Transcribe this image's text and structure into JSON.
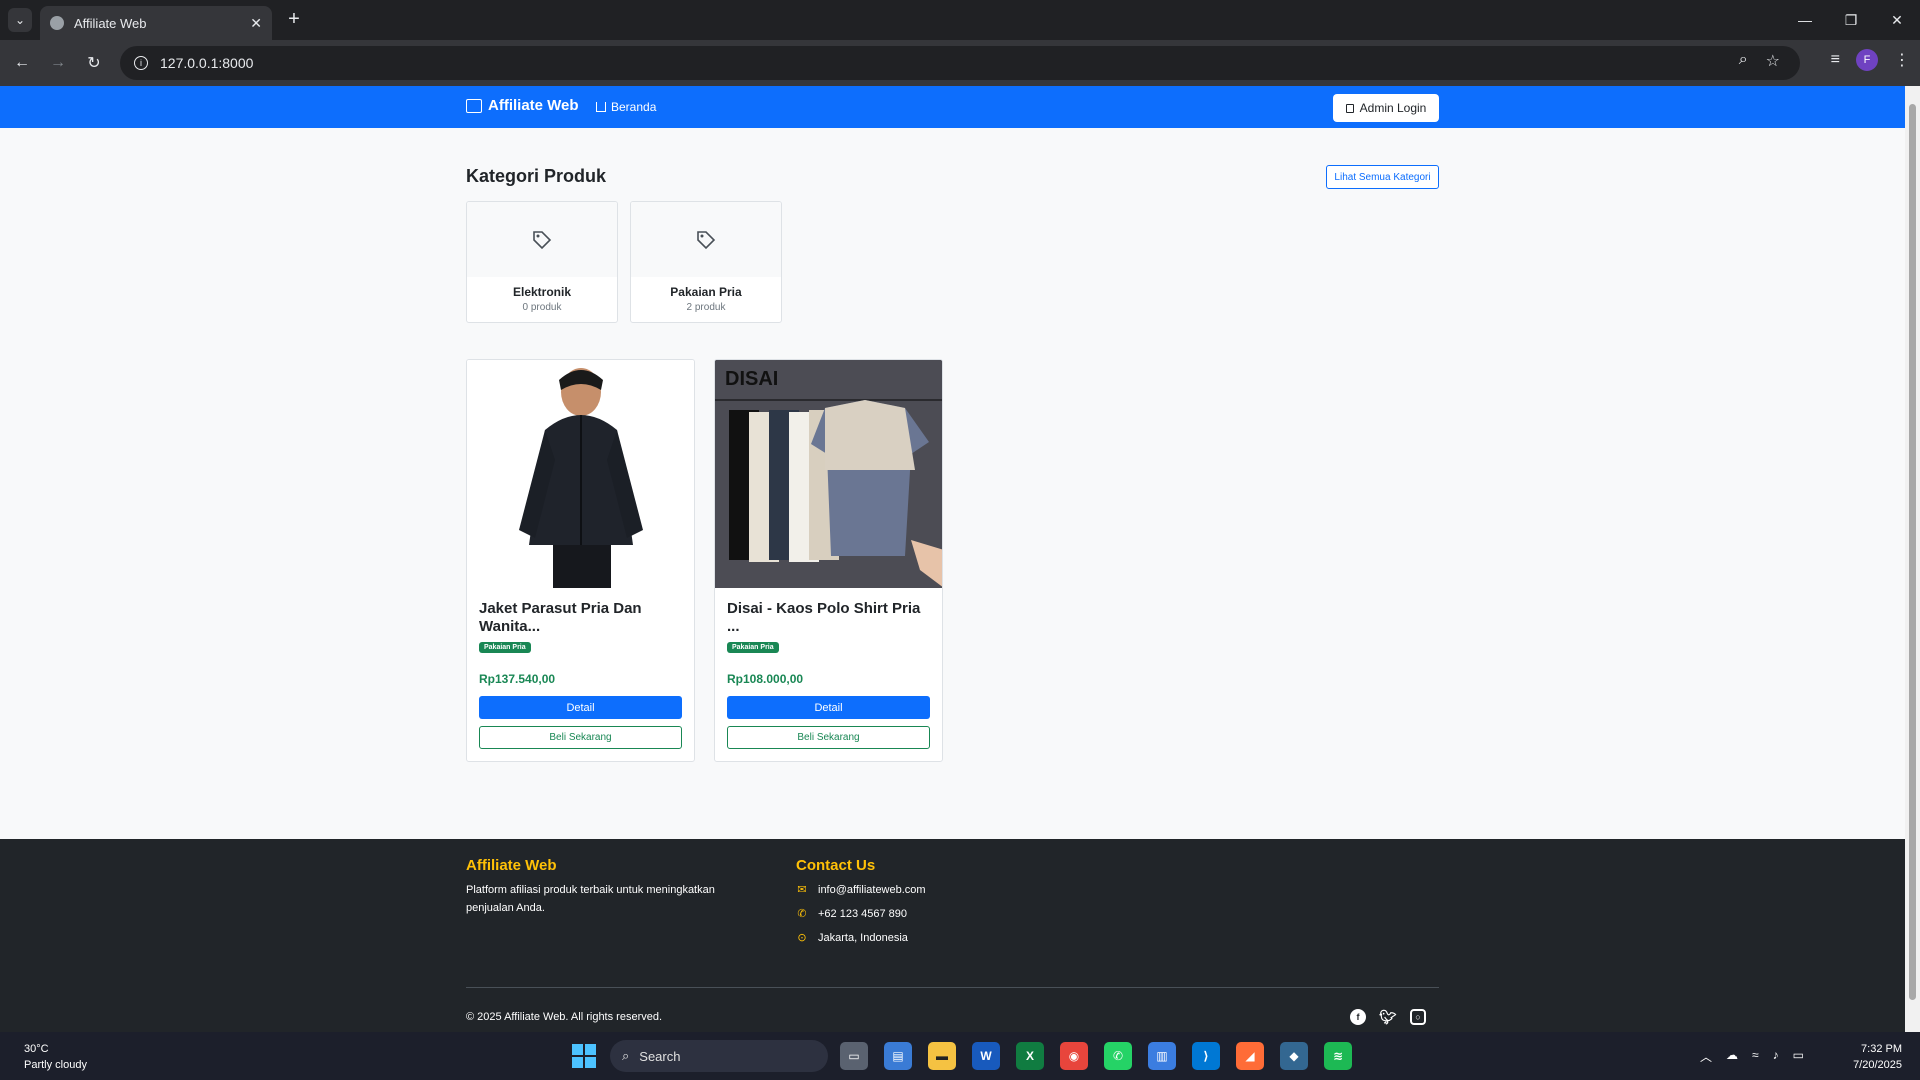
{
  "browser": {
    "tab_title": "Affiliate Web",
    "url": "127.0.0.1:8000"
  },
  "navbar": {
    "brand": "Affiliate Web",
    "home_label": "Beranda",
    "admin_login": "Admin Login"
  },
  "categories": {
    "title": "Kategori Produk",
    "view_all": "Lihat Semua Kategori",
    "items": [
      {
        "name": "Elektronik",
        "count": "0 produk"
      },
      {
        "name": "Pakaian Pria",
        "count": "2 produk"
      }
    ]
  },
  "products": [
    {
      "name": "Jaket Parasut Pria Dan Wanita...",
      "badge": "Pakaian Pria",
      "price": "Rp137.540,00",
      "detail": "Detail",
      "buy": "Beli Sekarang"
    },
    {
      "name": "Disai - Kaos Polo Shirt Pria ...",
      "badge": "Pakaian Pria",
      "price": "Rp108.000,00",
      "detail": "Detail",
      "buy": "Beli Sekarang",
      "image_text": "DISAI"
    }
  ],
  "footer": {
    "brand": "Affiliate Web",
    "description": "Platform afiliasi produk terbaik untuk meningkatkan penjualan Anda.",
    "contact_title": "Contact Us",
    "email": "info@affiliateweb.com",
    "phone": "+62 123 4567 890",
    "address": "Jakarta, Indonesia",
    "copyright": "© 2025 Affiliate Web. All rights reserved."
  },
  "taskbar": {
    "temperature": "30°C",
    "weather": "Partly cloudy",
    "search_placeholder": "Search",
    "time": "7:32 PM",
    "date": "7/20/2025"
  },
  "colors": {
    "primary": "#0d6efd",
    "success": "#198754",
    "footer_bg": "#212529",
    "footer_heading": "#ffc107"
  }
}
